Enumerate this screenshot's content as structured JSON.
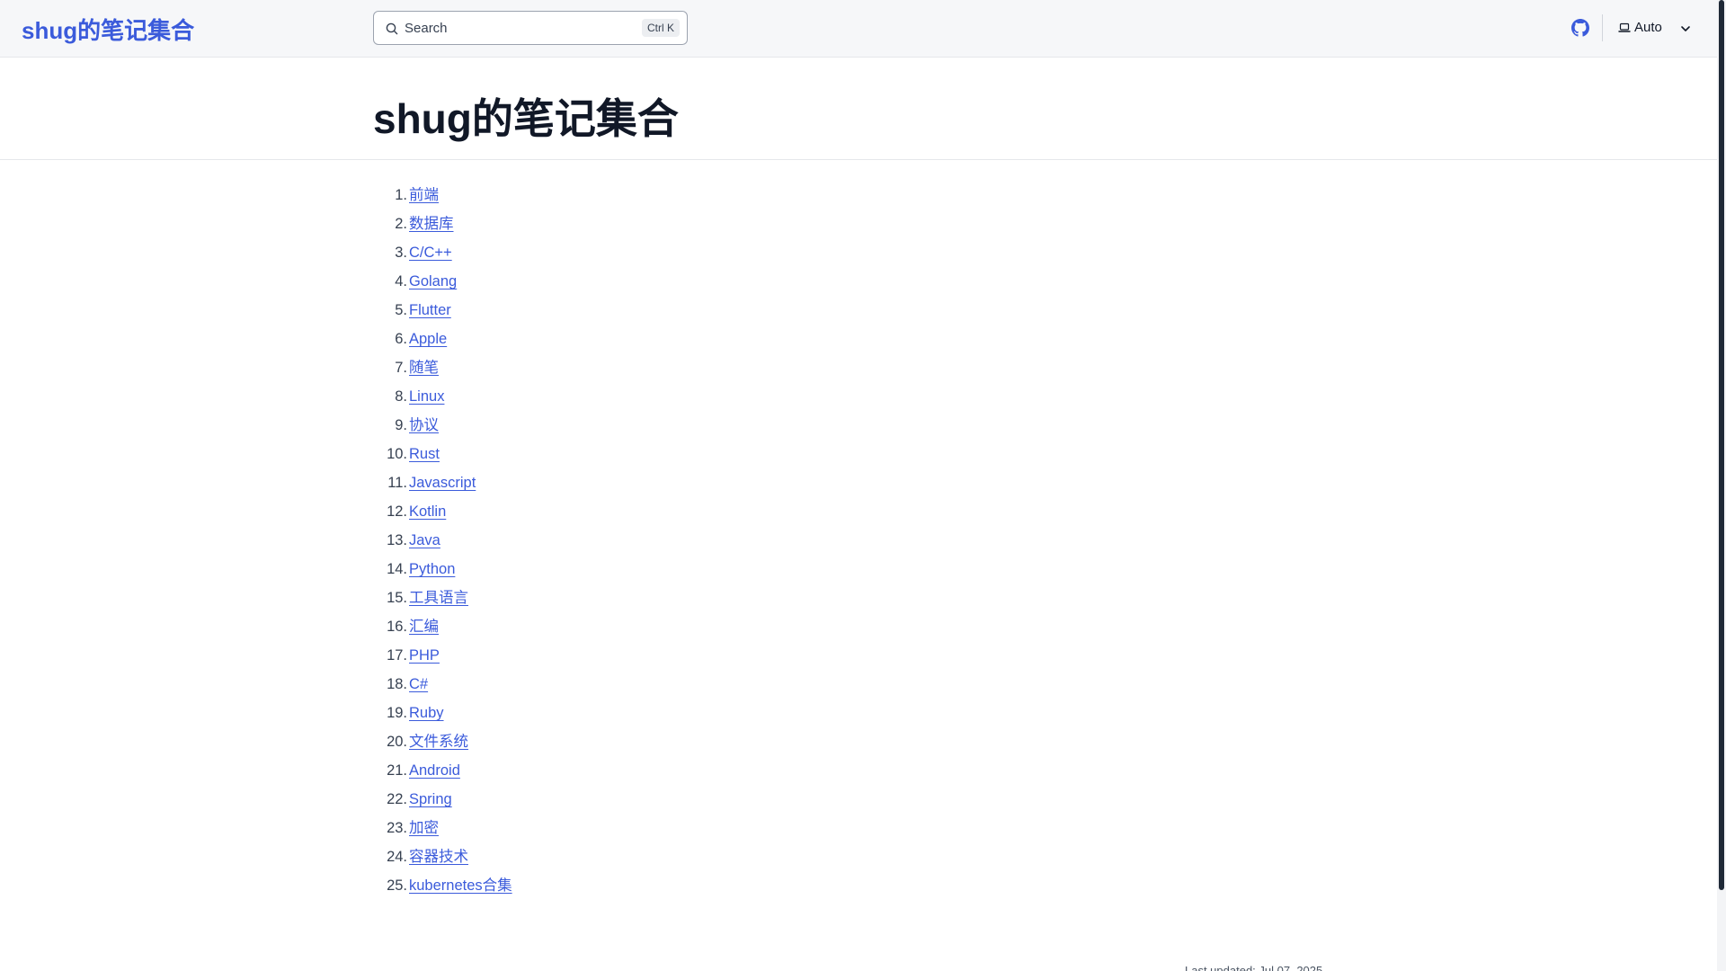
{
  "header": {
    "site_title": "shug的笔记集合",
    "search_placeholder": "Search",
    "search_shortcut": "Ctrl K",
    "theme_label": "Auto",
    "icons": {
      "search": "search-icon",
      "github": "github-icon",
      "theme": "laptop-icon",
      "dropdown": "chevron-down-icon"
    },
    "accent_color": "#3b5bdb"
  },
  "page": {
    "title": "shug的笔记集合",
    "items": [
      {
        "num": "1.",
        "label": "前端"
      },
      {
        "num": "2.",
        "label": "数据库"
      },
      {
        "num": "3.",
        "label": "C/C++"
      },
      {
        "num": "4.",
        "label": "Golang"
      },
      {
        "num": "5.",
        "label": "Flutter"
      },
      {
        "num": "6.",
        "label": "Apple"
      },
      {
        "num": "7.",
        "label": "随笔"
      },
      {
        "num": "8.",
        "label": "Linux"
      },
      {
        "num": "9.",
        "label": "协议"
      },
      {
        "num": "10.",
        "label": "Rust"
      },
      {
        "num": "11.",
        "label": "Javascript"
      },
      {
        "num": "12.",
        "label": "Kotlin"
      },
      {
        "num": "13.",
        "label": "Java"
      },
      {
        "num": "14.",
        "label": "Python"
      },
      {
        "num": "15.",
        "label": "工具语言"
      },
      {
        "num": "16.",
        "label": "汇编"
      },
      {
        "num": "17.",
        "label": "PHP"
      },
      {
        "num": "18.",
        "label": "C#"
      },
      {
        "num": "19.",
        "label": "Ruby"
      },
      {
        "num": "20.",
        "label": "文件系统"
      },
      {
        "num": "21.",
        "label": "Android"
      },
      {
        "num": "22.",
        "label": "Spring"
      },
      {
        "num": "23.",
        "label": "加密"
      },
      {
        "num": "24.",
        "label": "容器技术"
      },
      {
        "num": "25.",
        "label": "kubernetes合集"
      }
    ],
    "footer_note": "Last updated: Jul 07, 2025"
  }
}
